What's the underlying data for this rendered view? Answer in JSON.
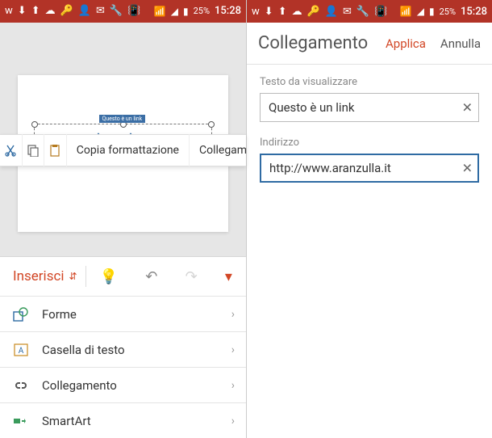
{
  "status": {
    "battery": "25%",
    "time": "15:28"
  },
  "context_menu": {
    "copy_format": "Copia formattazione",
    "link": "Collegamento"
  },
  "slide": {
    "link_chip": "Questo è un link"
  },
  "panel": {
    "tab": "Inserisci",
    "rows": {
      "shapes": "Forme",
      "textbox": "Casella di testo",
      "link": "Collegamento",
      "smartart": "SmartArt"
    }
  },
  "dialog": {
    "title": "Collegamento",
    "apply": "Applica",
    "cancel": "Annulla",
    "display_label": "Testo da visualizzare",
    "display_value": "Questo è un link",
    "address_label": "Indirizzo",
    "address_value": "http://www.aranzulla.it"
  },
  "colors": {
    "accent": "#d24726",
    "status_bg": "#b23327",
    "focus": "#2f6ba3"
  }
}
